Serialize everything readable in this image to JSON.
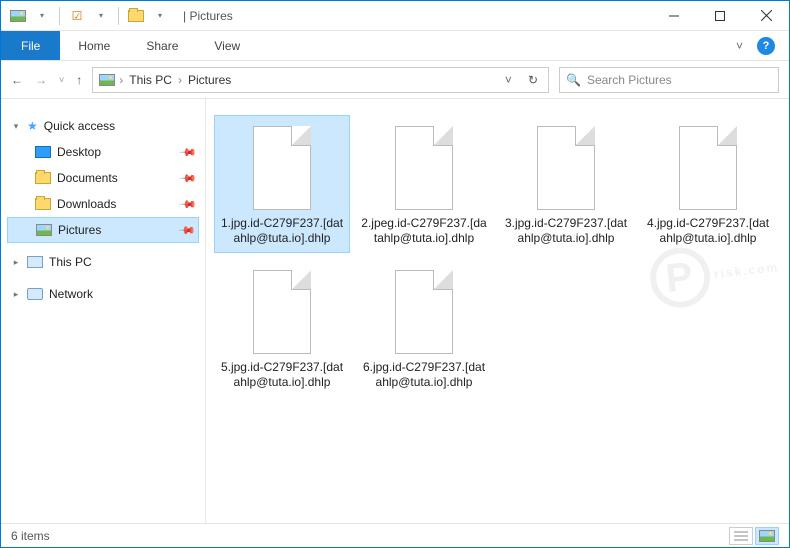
{
  "titlebar": {
    "title": "Pictures"
  },
  "tabs": {
    "file": "File",
    "home": "Home",
    "share": "Share",
    "view": "View"
  },
  "breadcrumb": {
    "seg1": "This PC",
    "seg2": "Pictures"
  },
  "search": {
    "placeholder": "Search Pictures"
  },
  "sidebar": {
    "quick": "Quick access",
    "desktop": "Desktop",
    "documents": "Documents",
    "downloads": "Downloads",
    "pictures": "Pictures",
    "thispc": "This PC",
    "network": "Network"
  },
  "files": [
    {
      "name": "1.jpg.id-C279F237.[datahlp@tuta.io].dhlp",
      "selected": true
    },
    {
      "name": "2.jpeg.id-C279F237.[datahlp@tuta.io].dhlp",
      "selected": false
    },
    {
      "name": "3.jpg.id-C279F237.[datahlp@tuta.io].dhlp",
      "selected": false
    },
    {
      "name": "4.jpg.id-C279F237.[datahlp@tuta.io].dhlp",
      "selected": false
    },
    {
      "name": "5.jpg.id-C279F237.[datahlp@tuta.io].dhlp",
      "selected": false
    },
    {
      "name": "6.jpg.id-C279F237.[datahlp@tuta.io].dhlp",
      "selected": false
    }
  ],
  "statusbar": {
    "count": "6 items"
  },
  "watermark": {
    "text": "risk.com"
  }
}
